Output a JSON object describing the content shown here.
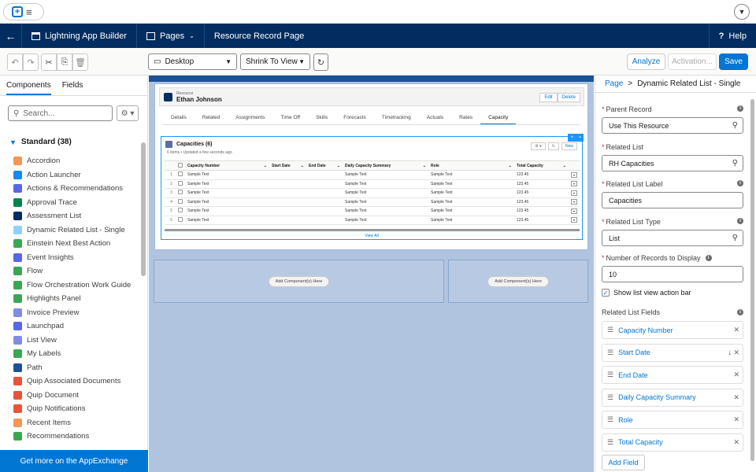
{
  "topbar": {
    "app_icon": "plus-icon",
    "menu_icon": "menu-icon",
    "user_icon": "chevron-down-icon"
  },
  "nav": {
    "back_icon": "back-arrow-icon",
    "builder": "Lightning App Builder",
    "pages": "Pages",
    "page_name": "Resource Record Page",
    "help": "Help"
  },
  "toolbar": {
    "device": "Desktop",
    "view": "Shrink To View",
    "analyze": "Analyze",
    "activation": "Activation...",
    "save": "Save"
  },
  "left": {
    "tabs": [
      "Components",
      "Fields"
    ],
    "search_placeholder": "Search...",
    "section": "Standard (38)",
    "components": [
      {
        "label": "Accordion",
        "color": "#f49756"
      },
      {
        "label": "Action Launcher",
        "color": "#1589ee"
      },
      {
        "label": "Actions & Recommendations",
        "color": "#5867e8"
      },
      {
        "label": "Approval Trace",
        "color": "#04844b"
      },
      {
        "label": "Assessment List",
        "color": "#032d60"
      },
      {
        "label": "Dynamic Related List - Single",
        "color": "#90d0fe"
      },
      {
        "label": "Einstein Next Best Action",
        "color": "#3ba755"
      },
      {
        "label": "Event Insights",
        "color": "#5867e8"
      },
      {
        "label": "Flow",
        "color": "#3ba755"
      },
      {
        "label": "Flow Orchestration Work Guide",
        "color": "#3ba755"
      },
      {
        "label": "Highlights Panel",
        "color": "#3ba755"
      },
      {
        "label": "Invoice Preview",
        "color": "#7f8de1"
      },
      {
        "label": "Launchpad",
        "color": "#5867e8"
      },
      {
        "label": "List View",
        "color": "#7f8de1"
      },
      {
        "label": "My Labels",
        "color": "#3ba755"
      },
      {
        "label": "Path",
        "color": "#1b5297"
      },
      {
        "label": "Quip Associated Documents",
        "color": "#e6543a"
      },
      {
        "label": "Quip Document",
        "color": "#e6543a"
      },
      {
        "label": "Quip Notifications",
        "color": "#e6543a"
      },
      {
        "label": "Recent Items",
        "color": "#f49756"
      },
      {
        "label": "Recommendations",
        "color": "#3ba755"
      }
    ],
    "appexchange": "Get more on the AppExchange"
  },
  "record": {
    "type": "Resource",
    "name": "Ethan Johnson",
    "edit": "Edit",
    "delete": "Delete",
    "tabs": [
      "Details",
      "Related",
      "Assignments",
      "Time Off",
      "Skills",
      "Forecasts",
      "Timetracking",
      "Actuals",
      "Rates",
      "Capacity"
    ],
    "active_tab": "Capacity"
  },
  "related_list": {
    "title": "Capacities (6)",
    "subtitle": "6 items • Updated a few seconds ago",
    "new": "New",
    "columns": [
      "Capacity Number",
      "Start Date",
      "End Date",
      "Daily Capacity Summary",
      "Role",
      "Total Capacity"
    ],
    "rows": [
      {
        "n": "1",
        "c": "Sample Text",
        "d": "Sample Text",
        "r": "Sample Text",
        "t": "123.45"
      },
      {
        "n": "2",
        "c": "Sample Text",
        "d": "Sample Text",
        "r": "Sample Text",
        "t": "123.45"
      },
      {
        "n": "3",
        "c": "Sample Text",
        "d": "Sample Text",
        "r": "Sample Text",
        "t": "123.45"
      },
      {
        "n": "4",
        "c": "Sample Text",
        "d": "Sample Text",
        "r": "Sample Text",
        "t": "123.45"
      },
      {
        "n": "5",
        "c": "Sample Text",
        "d": "Sample Text",
        "r": "Sample Text",
        "t": "123.45"
      },
      {
        "n": "6",
        "c": "Sample Text",
        "d": "Sample Text",
        "r": "Sample Text",
        "t": "123.45"
      }
    ],
    "view_all": "View All"
  },
  "zones": {
    "add": "Add Component(s) Here"
  },
  "right": {
    "breadcrumb_page": "Page",
    "breadcrumb_sep": ">",
    "breadcrumb_current": "Dynamic Related List - Single",
    "parent_record_label": "Parent Record",
    "parent_record_value": "Use This Resource",
    "related_list_label": "Related List",
    "related_list_value": "RH Capacities",
    "related_list_label_label": "Related List Label",
    "related_list_label_value": "Capacities",
    "related_list_type_label": "Related List Type",
    "related_list_type_value": "List",
    "num_records_label": "Number of Records to Display",
    "num_records_value": "10",
    "show_action_bar": "Show list view action bar",
    "fields_label": "Related List Fields",
    "fields": [
      "Capacity Number",
      "Start Date",
      "End Date",
      "Daily Capacity Summary",
      "Role",
      "Total Capacity"
    ],
    "add_field": "Add Field"
  }
}
